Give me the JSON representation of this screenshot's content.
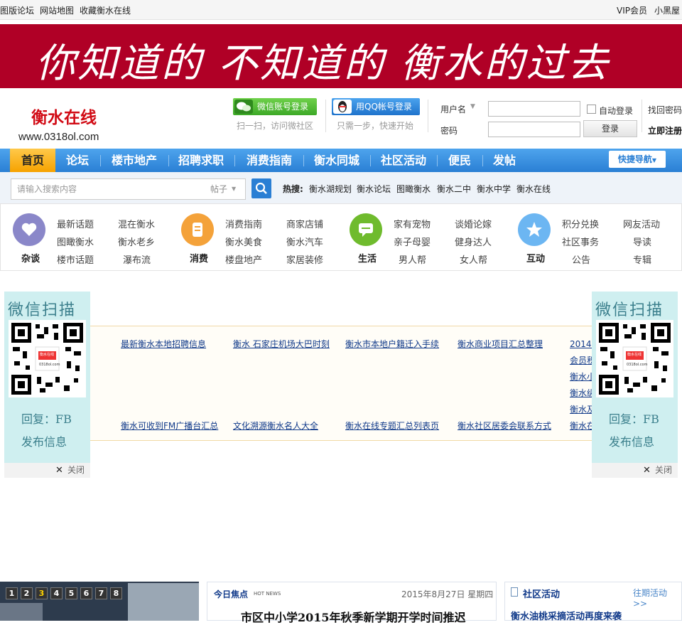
{
  "topbar": {
    "left": [
      "图版论坛",
      "网站地图",
      "收藏衡水在线"
    ],
    "right": [
      "VIP会员",
      "小黑屋"
    ]
  },
  "banner": {
    "text": "你知道的 不知道的 衡水的过去"
  },
  "logo": {
    "name": "衡水在线",
    "url": "www.0318ol.com"
  },
  "social_login": {
    "wechat": {
      "label": "微信账号登录",
      "sub": "扫一扫，访问微社区"
    },
    "qq": {
      "label": "用QQ帐号登录",
      "sub": "只需一步，快速开始"
    }
  },
  "login": {
    "username_label": "用户名",
    "password_label": "密码",
    "auto_login": "自动登录",
    "login_button": "登录",
    "forgot": "找回密码",
    "register": "立即注册"
  },
  "nav": {
    "items": [
      "首页",
      "论坛",
      "楼市地产",
      "招聘求职",
      "消费指南",
      "衡水同城",
      "社区活动",
      "便民",
      "发帖"
    ],
    "quick": "快捷导航"
  },
  "search": {
    "placeholder": "请输入搜索内容",
    "scope": "帖子",
    "hot_label": "热搜:",
    "hot": [
      "衡水湖规划",
      "衡水论坛",
      "图瞰衡水",
      "衡水二中",
      "衡水中学",
      "衡水在线"
    ]
  },
  "categories": [
    {
      "label": "杂谈",
      "color": "#8a87c9",
      "links": [
        "最新话题",
        "混在衡水",
        "图瞰衡水",
        "衡水老乡",
        "楼市话题",
        "瀑布流"
      ]
    },
    {
      "label": "消费",
      "color": "#f4a23a",
      "links": [
        "消费指南",
        "商家店铺",
        "衡水美食",
        "衡水汽车",
        "楼盘地产",
        "家居装修"
      ]
    },
    {
      "label": "生活",
      "color": "#6fbb2d",
      "links": [
        "家有宠物",
        "谈婚论嫁",
        "亲子母婴",
        "健身达人",
        "男人帮",
        "女人帮"
      ]
    },
    {
      "label": "互动",
      "color": "#6cb6f2",
      "links": [
        "积分兑换",
        "网友活动",
        "社区事务",
        "导读",
        "公告",
        "专辑"
      ]
    }
  ],
  "qr": {
    "title": "微信扫描",
    "brand": "衡水在线",
    "brand_url": "0318ol.com",
    "reply": "回复：FB",
    "publish": "发布信息",
    "close": "关闭"
  },
  "links": {
    "row1": [
      "最新衡水本地招聘信息",
      "衡水 石家庄机场大巴时刻",
      "衡水市本地户籍迁入手续",
      "衡水商业项目汇总整理",
      "2014年"
    ],
    "col5": [
      "会员积",
      "衡水小",
      "衡水纵",
      "衡水及"
    ],
    "row_last": [
      "衡水可收到FM广播台汇总",
      "文化溯源衡水名人大全",
      "衡水在线专题汇总列表页",
      "衡水社区居委会联系方式",
      "衡水在"
    ]
  },
  "slider": {
    "pages": [
      "1",
      "2",
      "3",
      "4",
      "5",
      "6",
      "7",
      "8"
    ],
    "active": 2
  },
  "focus": {
    "title": "今日焦点",
    "sub": "HOT NEWS",
    "date": "2015年8月27日 星期四",
    "headline": "市区中小学2015年秋季新学期开学时间推迟"
  },
  "community": {
    "title": "社区活动",
    "more": "往期活动>>",
    "item": "衡水油桃采摘活动再度来袭"
  }
}
